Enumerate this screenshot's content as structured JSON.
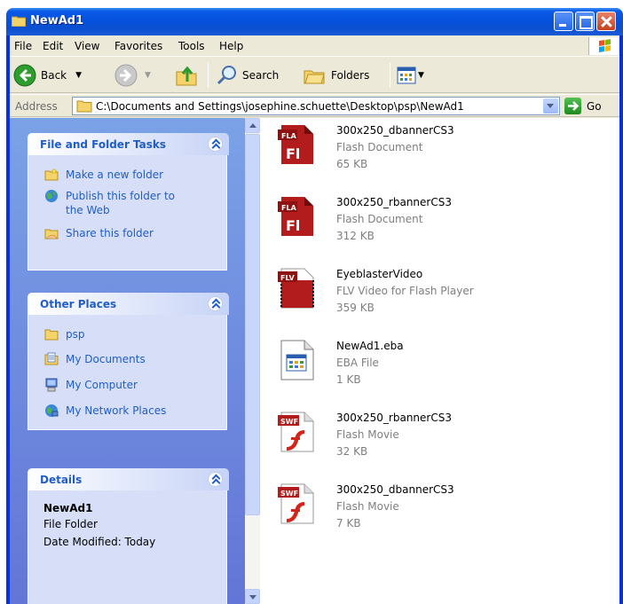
{
  "window": {
    "title": "NewAd1"
  },
  "menu": [
    "File",
    "Edit",
    "View",
    "Favorites",
    "Tools",
    "Help"
  ],
  "toolbar": {
    "back_label": "Back",
    "search_label": "Search",
    "folders_label": "Folders"
  },
  "address": {
    "label": "Address",
    "path": "C:\\Documents and Settings\\josephine.schuette\\Desktop\\psp\\NewAd1",
    "go_label": "Go"
  },
  "tasks_panel": {
    "title": "File and Folder Tasks",
    "items": [
      {
        "label": "Make a new folder",
        "icon": "new-folder-icon"
      },
      {
        "label": "Publish this folder to the Web",
        "icon": "publish-web-icon"
      },
      {
        "label": "Share this folder",
        "icon": "share-folder-icon"
      }
    ]
  },
  "places_panel": {
    "title": "Other Places",
    "items": [
      {
        "label": "psp",
        "icon": "folder-icon"
      },
      {
        "label": "My Documents",
        "icon": "my-documents-icon"
      },
      {
        "label": "My Computer",
        "icon": "my-computer-icon"
      },
      {
        "label": "My Network Places",
        "icon": "network-places-icon"
      }
    ]
  },
  "details_panel": {
    "title": "Details",
    "name": "NewAd1",
    "type": "File Folder",
    "modified": "Date Modified: Today"
  },
  "files": [
    {
      "name": "300x250_dbannerCS3",
      "type": "Flash Document",
      "size": "65 KB",
      "icon": "fla-icon"
    },
    {
      "name": "300x250_rbannerCS3",
      "type": "Flash Document",
      "size": "312 KB",
      "icon": "fla-icon"
    },
    {
      "name": "EyeblasterVideo",
      "type": "FLV Video for Flash Player",
      "size": "359 KB",
      "icon": "flv-icon"
    },
    {
      "name": "NewAd1.eba",
      "type": "EBA File",
      "size": "1 KB",
      "icon": "eba-icon"
    },
    {
      "name": "300x250_rbannerCS3",
      "type": "Flash Movie",
      "size": "32 KB",
      "icon": "swf-icon"
    },
    {
      "name": "300x250_dbannerCS3",
      "type": "Flash Movie",
      "size": "7 KB",
      "icon": "swf-icon"
    }
  ],
  "colors": {
    "title_blue": "#0a5ae6",
    "link_blue": "#215dc6",
    "taskpane": "#7ba2e7",
    "flash_red": "#b81c1c"
  }
}
